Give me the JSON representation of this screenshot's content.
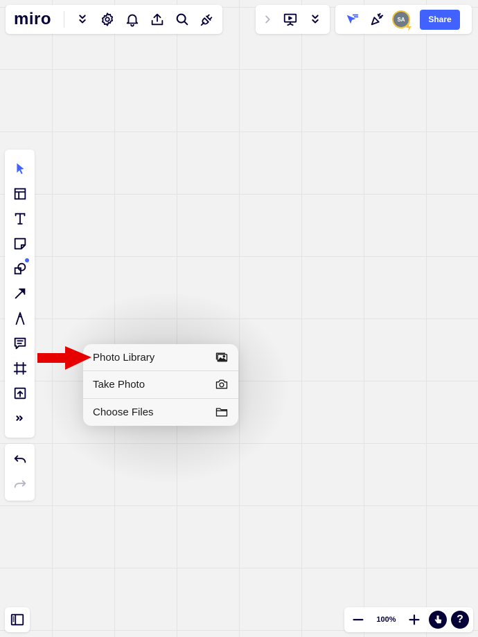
{
  "toolbar": {
    "logo": "miro",
    "share_label": "Share",
    "avatar_initials": "SA",
    "icons": [
      "chevron-double-down-icon",
      "gear-icon",
      "bell-icon",
      "upload-icon",
      "search-icon",
      "plug-icon"
    ],
    "right_icons": [
      "chevron-right-icon",
      "presentation-icon",
      "chevron-double-down-icon",
      "cursor-filter-icon",
      "celebrate-icon"
    ]
  },
  "left_toolbar": {
    "tools": [
      "select-arrow-icon",
      "templates-icon",
      "text-icon",
      "sticky-note-icon",
      "shapes-icon",
      "connector-arrow-icon",
      "pen-icon",
      "comment-icon",
      "frame-icon",
      "upload-icon",
      "more-icon"
    ],
    "history": [
      "undo-icon",
      "redo-icon"
    ]
  },
  "zoom": {
    "level": "100%",
    "help_label": "?"
  },
  "upload_menu": {
    "items": [
      {
        "label": "Photo Library",
        "icon": "photo-library-icon"
      },
      {
        "label": "Take Photo",
        "icon": "camera-icon"
      },
      {
        "label": "Choose Files",
        "icon": "folder-icon"
      }
    ]
  },
  "colors": {
    "accent": "#4262ff",
    "ink": "#050038",
    "annotation_arrow": "#e60000",
    "avatar_ring": "#f5c33b"
  }
}
